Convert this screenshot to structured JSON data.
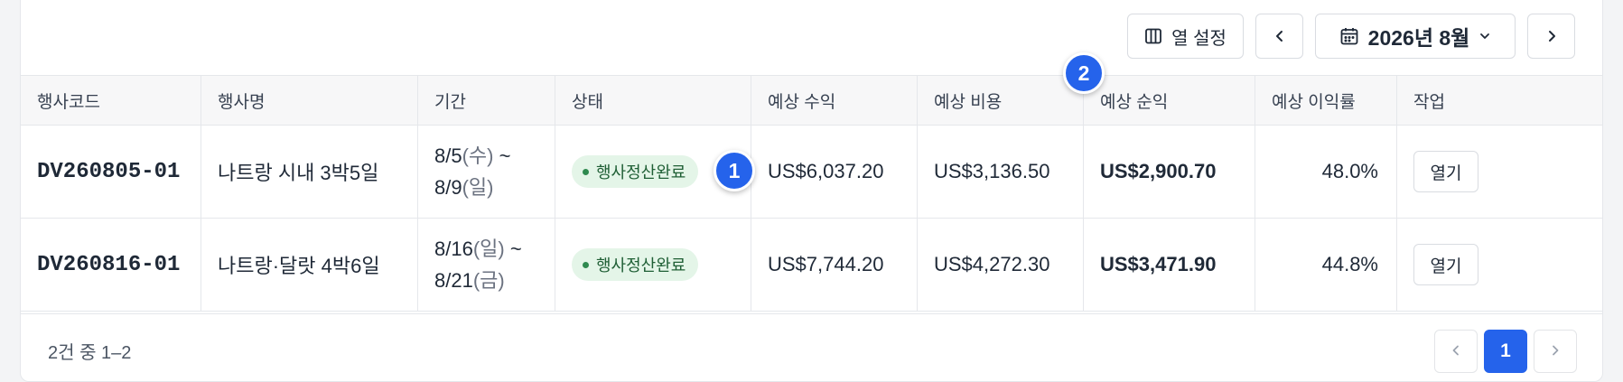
{
  "toolbar": {
    "columns_label": "열 설정",
    "month_label": "2026년 8월"
  },
  "table": {
    "headers": [
      "행사코드",
      "행사명",
      "기간",
      "상태",
      "예상 수익",
      "예상 비용",
      "예상 순익",
      "예상 이익률",
      "작업"
    ],
    "rows": [
      {
        "code": "DV260805-01",
        "name": "나트랑 시내 3박5일",
        "period_start": "8/5",
        "period_start_dow": "(수)",
        "tilde": " ~",
        "period_end": "8/9",
        "period_end_dow": "(일)",
        "status": "행사정산완료",
        "revenue": "US$6,037.20",
        "cost": "US$3,136.50",
        "profit": "US$2,900.70",
        "margin": "48.0%",
        "action": "열기"
      },
      {
        "code": "DV260816-01",
        "name": "나트랑·달랏 4박6일",
        "period_start": "8/16",
        "period_start_dow": "(일)",
        "tilde": " ~",
        "period_end": "8/21",
        "period_end_dow": "(금)",
        "status": "행사정산완료",
        "revenue": "US$7,744.20",
        "cost": "US$4,272.30",
        "profit": "US$3,471.90",
        "margin": "44.8%",
        "action": "열기"
      }
    ]
  },
  "footer": {
    "summary": "2건 중 1–2",
    "current_page": "1"
  },
  "markers": [
    "1",
    "2"
  ],
  "colors": {
    "accent": "#2563eb",
    "badge_bg": "#e4f5e8",
    "badge_text": "#1f5f35",
    "badge_dot": "#2f8a4f"
  },
  "icons": [
    "columns-icon",
    "chevron-left-icon",
    "calendar-icon",
    "chevron-down-icon",
    "chevron-right-icon"
  ]
}
